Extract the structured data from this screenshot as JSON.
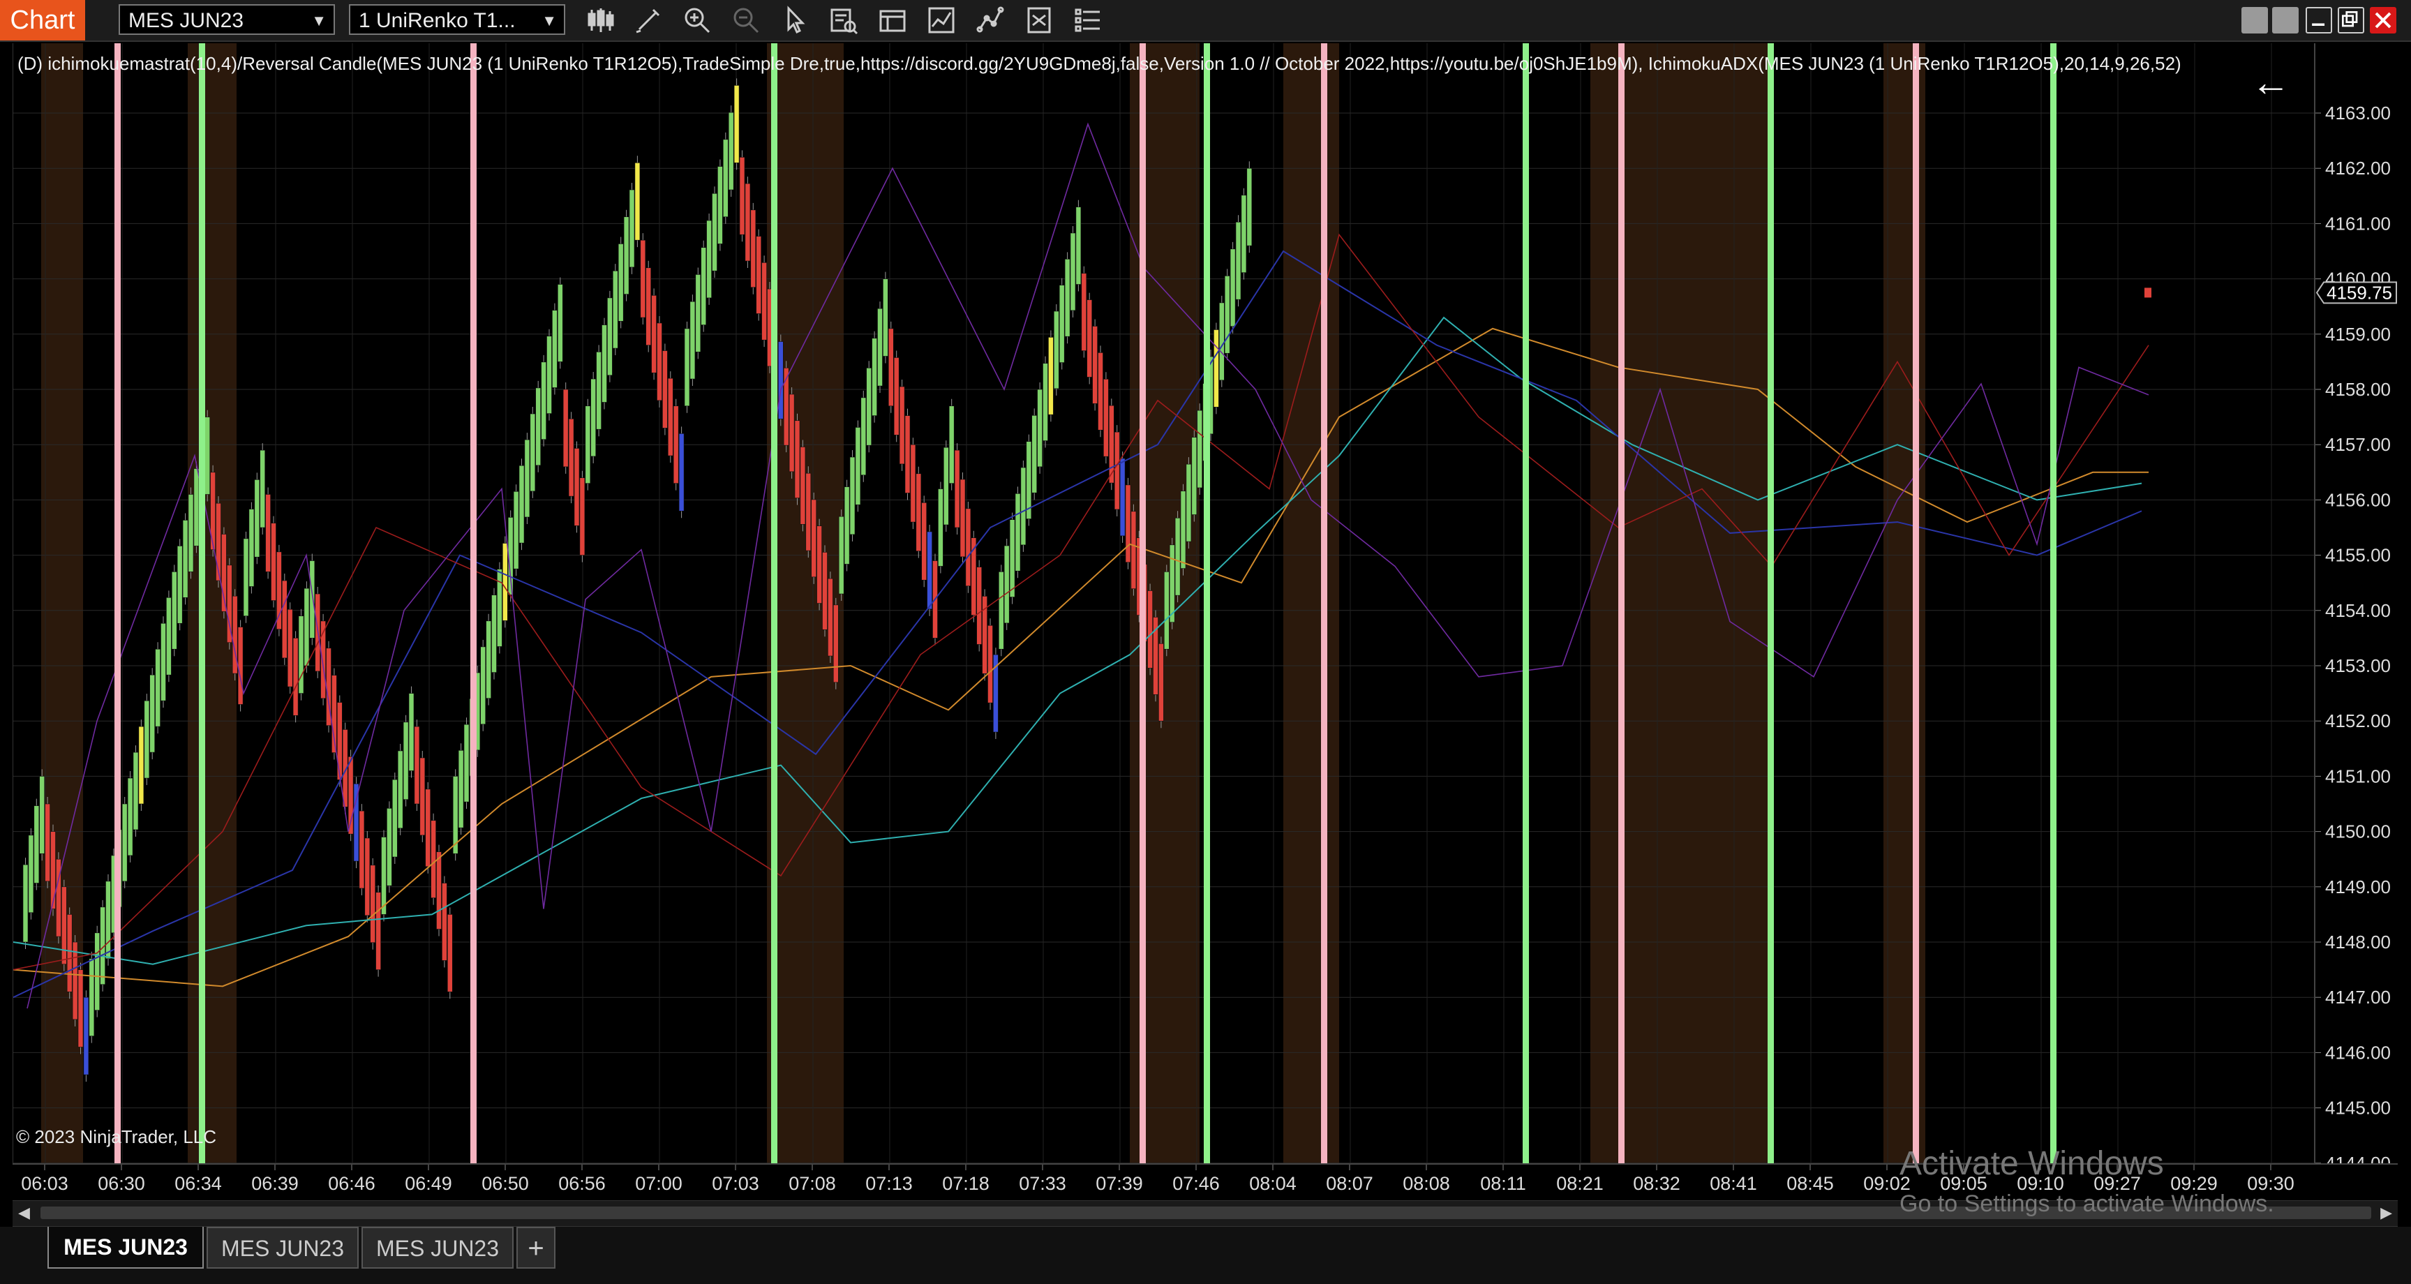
{
  "toolbar": {
    "chart_label": "Chart",
    "instrument": "MES JUN23",
    "bar_type": "1 UniRenko T1...",
    "tools": [
      "bar-style-icon",
      "draw-tool-icon",
      "zoom-in-icon",
      "zoom-out-icon",
      "select-pointer-icon",
      "data-box-icon",
      "chart-properties-icon",
      "indicators-icon",
      "strategies-icon",
      "chart-trader-icon",
      "instrument-list-icon"
    ]
  },
  "window_controls": [
    "minimize",
    "maximize",
    "restore",
    "close"
  ],
  "chart": {
    "indicator_caption": "(D) ichimokuemastrat(10,4)/Reversal Candle(MES JUN23 (1 UniRenko T1R12O5),TradeSimple Dre,true,https://discord.gg/2YU9GDme8j,false,Version 1.0 // October 2022,https://youtu.be/oj0ShJE1b9M), IchimokuADX(MES JUN23 (1 UniRenko T1R12O5),20,14,9,26,52)",
    "copyright": "© 2023 NinjaTrader, LLC",
    "current_price": "4159.75",
    "price_ticks": [
      "4163.00",
      "4162.00",
      "4161.00",
      "4160.00",
      "4159.00",
      "4158.00",
      "4157.00",
      "4156.00",
      "4155.00",
      "4154.00",
      "4153.00",
      "4152.00",
      "4151.00",
      "4150.00",
      "4149.00",
      "4148.00",
      "4147.00",
      "4146.00",
      "4145.00",
      "4144.00"
    ],
    "time_ticks": [
      "06:03",
      "06:30",
      "06:34",
      "06:39",
      "06:46",
      "06:49",
      "06:50",
      "06:56",
      "07:00",
      "07:03",
      "07:08",
      "07:13",
      "07:18",
      "07:33",
      "07:39",
      "07:46",
      "08:04",
      "08:07",
      "08:08",
      "08:11",
      "08:21",
      "08:32",
      "08:41",
      "08:45",
      "09:02",
      "09:05",
      "09:10",
      "09:27",
      "09:29",
      "09:30"
    ],
    "colors": {
      "up": "#7ed36a",
      "down": "#e0423a",
      "neutral_up": "#f1e84a",
      "neutral_down": "#3a4fd8",
      "green_line": "#8ef08a",
      "pink_line": "#f5b3c0",
      "shade": "#3a2210"
    }
  },
  "chart_data": {
    "type": "candlestick",
    "instrument": "MES JUN23",
    "ylim": [
      4144.0,
      4163.5
    ],
    "price_ticks": [
      4163,
      4162,
      4161,
      4160,
      4159,
      4158,
      4157,
      4156,
      4155,
      4154,
      4153,
      4152,
      4151,
      4150,
      4149,
      4148,
      4147,
      4146,
      4145,
      4144
    ],
    "legs": [
      {
        "dir": "up",
        "from": 4148.7,
        "to": 4150.3
      },
      {
        "dir": "down",
        "from": 4149.8,
        "to": 4146.3
      },
      {
        "dir": "up",
        "from": 4147.0,
        "to": 4156.8
      },
      {
        "dir": "down",
        "from": 4155.8,
        "to": 4153.0
      },
      {
        "dir": "up",
        "from": 4154.6,
        "to": 4156.2
      },
      {
        "dir": "down",
        "from": 4155.4,
        "to": 4152.8
      },
      {
        "dir": "up",
        "from": 4153.2,
        "to": 4154.2
      },
      {
        "dir": "down",
        "from": 4153.6,
        "to": 4148.2
      },
      {
        "dir": "up",
        "from": 4149.2,
        "to": 4151.8
      },
      {
        "dir": "down",
        "from": 4151.2,
        "to": 4147.8
      },
      {
        "dir": "up",
        "from": 4150.3,
        "to": 4159.2
      },
      {
        "dir": "down",
        "from": 4157.3,
        "to": 4155.7
      },
      {
        "dir": "up",
        "from": 4157.0,
        "to": 4161.4
      },
      {
        "dir": "down",
        "from": 4160.0,
        "to": 4156.5
      },
      {
        "dir": "up",
        "from": 4158.4,
        "to": 4162.8
      },
      {
        "dir": "down",
        "from": 4161.5,
        "to": 4153.4
      },
      {
        "dir": "up",
        "from": 4155.0,
        "to": 4159.3
      },
      {
        "dir": "down",
        "from": 4158.4,
        "to": 4154.2
      },
      {
        "dir": "up",
        "from": 4155.5,
        "to": 4157.0
      },
      {
        "dir": "down",
        "from": 4156.2,
        "to": 4152.5
      },
      {
        "dir": "up",
        "from": 4154.0,
        "to": 4160.6
      },
      {
        "dir": "down",
        "from": 4159.4,
        "to": 4152.7
      },
      {
        "dir": "up",
        "from": 4154.0,
        "to": 4161.3
      }
    ],
    "last_price": 4159.75
  }
}
